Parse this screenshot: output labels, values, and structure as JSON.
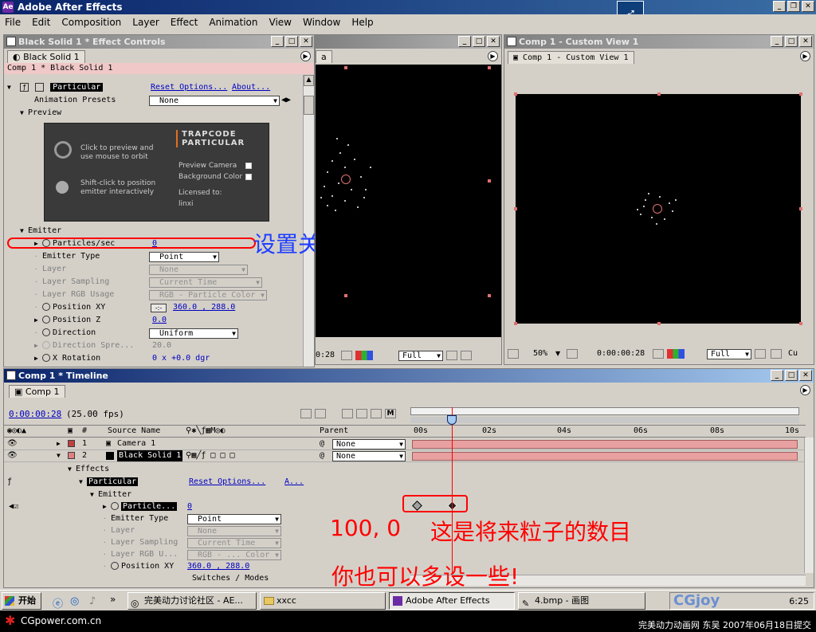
{
  "window": {
    "title": "Adobe After Effects",
    "icon": "after-effects-icon"
  },
  "menu": [
    "File",
    "Edit",
    "Composition",
    "Layer",
    "Effect",
    "Animation",
    "View",
    "Window",
    "Help"
  ],
  "effect_controls": {
    "title": "Black Solid 1 * Effect Controls",
    "tab": "Black Solid 1",
    "breadcrumb": "Comp 1 * Black Solid 1",
    "effect_name": "Particular",
    "reset_options": "Reset Options...",
    "about": "About...",
    "animation_presets_label": "Animation Presets",
    "animation_presets_value": "None",
    "preview_label": "Preview",
    "preview_box": {
      "hint1": "Click to preview and use mouse to orbit",
      "hint2": "Shift-click to position emitter interactively",
      "logo_line1": "TRAPCODE",
      "logo_line2": "PARTICULAR",
      "preview_camera": "Preview Camera",
      "background_color": "Background Color",
      "licensed_to": "Licensed to:",
      "licensee": "linxi"
    },
    "emitter_label": "Emitter",
    "params": [
      {
        "label": "Particles/sec",
        "value": "0"
      },
      {
        "label": "Emitter Type",
        "value": "Point"
      },
      {
        "label": "Layer",
        "value": "None"
      },
      {
        "label": "Layer Sampling",
        "value": "Current Time"
      },
      {
        "label": "Layer RGB Usage",
        "value": "RGB - Particle Color"
      },
      {
        "label": "Position XY",
        "value": "360.0 , 288.0"
      },
      {
        "label": "Position Z",
        "value": "0.0"
      },
      {
        "label": "Direction",
        "value": "Uniform"
      },
      {
        "label": "Direction Spre...",
        "value": "20.0"
      },
      {
        "label": "X Rotation",
        "value": "0 x +0.0 dgr"
      }
    ]
  },
  "comp_viewer": {
    "tab_partial": "a",
    "timecode": "0:28",
    "resolution": "Full"
  },
  "custom_view": {
    "title": "Comp 1 - Custom View 1",
    "tab": "Comp 1 - Custom View 1",
    "zoom": "50%",
    "timecode": "0:00:00:28",
    "resolution": "Full",
    "camera_partial": "Cu"
  },
  "timeline": {
    "title": "Comp 1 * Timeline",
    "tab": "Comp 1",
    "timecode": "0:00:00:28",
    "fps": "(25.00 fps)",
    "columns": {
      "num": "#",
      "source": "Source Name",
      "parent": "Parent"
    },
    "ruler": [
      "00s",
      "02s",
      "04s",
      "06s",
      "08s",
      "10s"
    ],
    "layers": [
      {
        "num": "1",
        "name": "Camera 1",
        "parent": "None",
        "color": "#c04040"
      },
      {
        "num": "2",
        "name": "Black Solid 1",
        "parent": "None",
        "color": "#e08080"
      }
    ],
    "effects_label": "Effects",
    "effect_name": "Particular",
    "reset_options": "Reset Options...",
    "about": "A...",
    "emitter_label": "Emitter",
    "props": [
      {
        "label": "Particle...",
        "value": "0"
      },
      {
        "label": "Emitter Type",
        "value": "Point"
      },
      {
        "label": "Layer",
        "value": "None"
      },
      {
        "label": "Layer Sampling",
        "value": "Current Time"
      },
      {
        "label": "Layer RGB U...",
        "value": "RGB - ... Color"
      },
      {
        "label": "Position XY",
        "value": "360.0 , 288.0"
      }
    ],
    "switches_modes": "Switches / Modes"
  },
  "annotations": {
    "set_keyframe": "设置关键帧",
    "values": "100, 0",
    "particle_count": "这是将来粒子的数目",
    "set_more": "你也可以多设一些!"
  },
  "taskbar": {
    "start": "开始",
    "items": [
      {
        "label": "完美动力讨论社区 - AE...",
        "icon": "browser-icon"
      },
      {
        "label": "xxcc",
        "icon": "folder-icon"
      },
      {
        "label": "Adobe After Effects",
        "icon": "after-effects-icon"
      },
      {
        "label": "4.bmp - 画图",
        "icon": "paint-icon"
      }
    ],
    "clock": "6:25"
  },
  "footer": {
    "site": "CGpower.com.cn",
    "credit": "完美动力动画网 东吴 2007年06月18日提交",
    "watermark": "CGjoy"
  },
  "colors": {
    "accent": "#0a246a",
    "annotation_red": "#ff0000",
    "annotation_blue": "#1f3fff"
  }
}
